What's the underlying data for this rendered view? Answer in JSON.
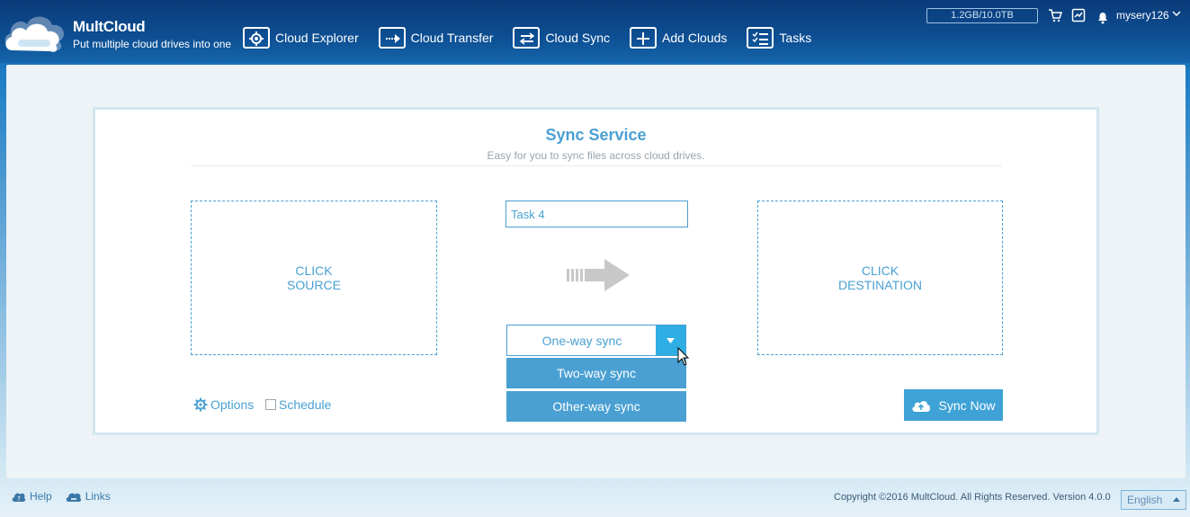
{
  "header": {
    "logo_title": "MultCloud",
    "logo_subtitle": "Put multiple cloud drives into one",
    "nav": [
      {
        "label": "Cloud Explorer",
        "icon": "gear-icon"
      },
      {
        "label": "Cloud Transfer",
        "icon": "transfer-icon"
      },
      {
        "label": "Cloud Sync",
        "icon": "sync-icon"
      },
      {
        "label": "Add Clouds",
        "icon": "plus-icon"
      },
      {
        "label": "Tasks",
        "icon": "tasks-icon"
      }
    ],
    "storage": "1.2GB/10.0TB",
    "username": "mysery126"
  },
  "main": {
    "title": "Sync Service",
    "subtitle": "Easy for you to sync files across cloud drives.",
    "source_line1": "CLICK",
    "source_line2": "SOURCE",
    "dest_line1": "CLICK",
    "dest_line2": "DESTINATION",
    "task_name": "Task 4",
    "sync_mode_selected": "One-way sync",
    "sync_mode_options": [
      "Two-way sync",
      "Other-way sync"
    ],
    "options_label": "Options",
    "schedule_label": "Schedule",
    "sync_now_label": "Sync Now"
  },
  "footer": {
    "help": "Help",
    "links": "Links",
    "copyright": "Copyright ©2016 MultCloud. All Rights Reserved. Version 4.0.0",
    "language": "English"
  },
  "colors": {
    "accent": "#4aa0d2",
    "header_bg": "#0d4f93",
    "dropdown_button": "#2eaee4"
  }
}
